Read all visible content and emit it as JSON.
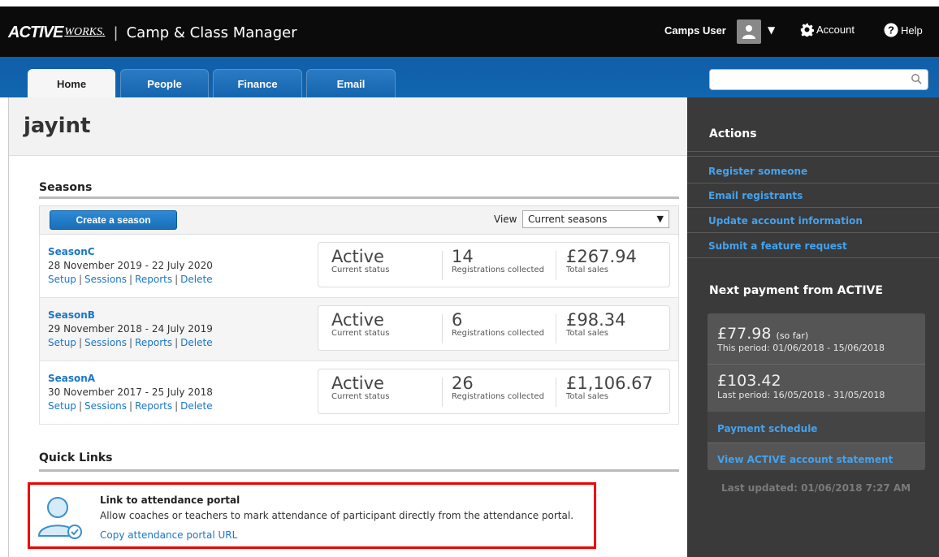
{
  "header": {
    "logo_active": "ACTIVE",
    "logo_works": "WORKS.",
    "app_title": "Camp & Class Manager",
    "user_name": "Camps User",
    "account_label": "Account",
    "help_label": "Help"
  },
  "nav": {
    "tabs": [
      {
        "label": "Home",
        "active": true
      },
      {
        "label": "People",
        "active": false
      },
      {
        "label": "Finance",
        "active": false
      },
      {
        "label": "Email",
        "active": false
      }
    ],
    "search_placeholder": ""
  },
  "page": {
    "title": "jayint"
  },
  "seasons": {
    "heading": "Seasons",
    "create_button": "Create a season",
    "view_label": "View",
    "view_selected": "Current seasons",
    "rows": [
      {
        "name": "SeasonC",
        "dates": "28 November 2019 - 22 July 2020",
        "links": [
          "Setup",
          "Sessions",
          "Reports",
          "Delete"
        ],
        "status": "Active",
        "status_label": "Current status",
        "registrations": "14",
        "registrations_label": "Registrations collected",
        "sales": "£267.94",
        "sales_label": "Total sales"
      },
      {
        "name": "SeasonB",
        "dates": "29 November 2018 - 24 July 2019",
        "links": [
          "Setup",
          "Sessions",
          "Reports",
          "Delete"
        ],
        "status": "Active",
        "status_label": "Current status",
        "registrations": "6",
        "registrations_label": "Registrations collected",
        "sales": "£98.34",
        "sales_label": "Total sales"
      },
      {
        "name": "SeasonA",
        "dates": "30 November 2017 - 25 July 2018",
        "links": [
          "Setup",
          "Sessions",
          "Reports",
          "Delete"
        ],
        "status": "Active",
        "status_label": "Current status",
        "registrations": "26",
        "registrations_label": "Registrations collected",
        "sales": "£1,106.67",
        "sales_label": "Total sales"
      }
    ]
  },
  "quick_links": {
    "heading": "Quick Links",
    "item_title": "Link to attendance portal",
    "item_desc": "Allow coaches or teachers to mark attendance of participant directly from the attendance portal.",
    "item_link": "Copy attendance portal URL"
  },
  "sidebar": {
    "actions_title": "Actions",
    "actions": [
      "Register someone",
      "Email registrants",
      "Update account information",
      "Submit a feature request"
    ],
    "payment_title": "Next payment from ACTIVE",
    "current_amount": "£77.98",
    "current_suffix": "(so far)",
    "current_period": "This period: 01/06/2018 - 15/06/2018",
    "last_amount": "£103.42",
    "last_period": "Last period: 16/05/2018 - 31/05/2018",
    "payment_schedule": "Payment schedule",
    "statement_link": "View ACTIVE account statement",
    "last_updated": "Last updated: 01/06/2018 7:27 AM"
  },
  "colors": {
    "nav_blue": "#1166b0",
    "link_blue": "#1b76c8",
    "sidebar_bg": "#3a3a3a",
    "highlight_red": "#ee0000"
  }
}
